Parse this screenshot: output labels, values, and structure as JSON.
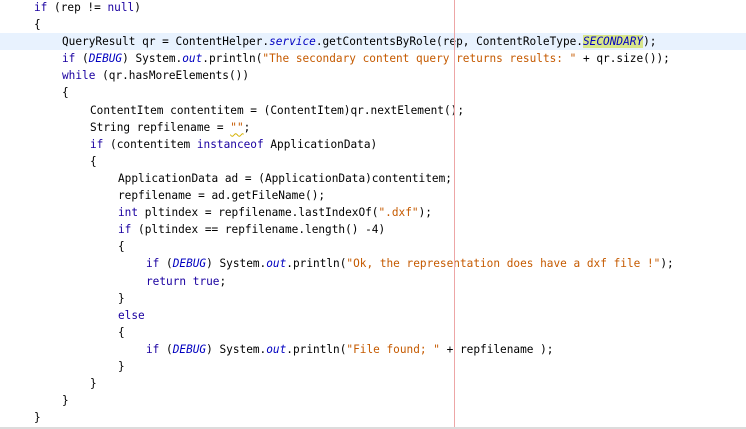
{
  "editor": {
    "lines": [
      {
        "tokens": [
          {
            "t": "if",
            "c": "kw"
          },
          {
            "t": " (rep != "
          },
          {
            "t": "null",
            "c": "kw"
          },
          {
            "t": ")"
          }
        ]
      },
      {
        "tokens": [
          {
            "t": "{"
          }
        ]
      },
      {
        "indent": 1,
        "current": true,
        "tokens": [
          {
            "t": "QueryResult qr = ContentHelper."
          },
          {
            "t": "service",
            "c": "field"
          },
          {
            "t": ".getContentsByRole(rep, ContentRoleType."
          },
          {
            "t": "SECONDARY",
            "c": "field hl"
          },
          {
            "t": ");"
          }
        ]
      },
      {
        "indent": 1,
        "tokens": [
          {
            "t": "if",
            "c": "kw"
          },
          {
            "t": " ("
          },
          {
            "t": "DEBUG",
            "c": "field"
          },
          {
            "t": ") System."
          },
          {
            "t": "out",
            "c": "field"
          },
          {
            "t": ".println("
          },
          {
            "t": "\"The secondary content query returns results: \"",
            "c": "str"
          },
          {
            "t": " + qr.size());"
          }
        ]
      },
      {
        "indent": 1,
        "tokens": [
          {
            "t": "while",
            "c": "kw"
          },
          {
            "t": " (qr.hasMoreElements())"
          }
        ]
      },
      {
        "indent": 1,
        "tokens": [
          {
            "t": "{"
          }
        ]
      },
      {
        "indent": 2,
        "tokens": [
          {
            "t": "ContentItem contentitem = (ContentItem)qr.nextElement();"
          }
        ]
      },
      {
        "indent": 2,
        "tokens": [
          {
            "t": "String repfilename = "
          },
          {
            "t": "\"\"",
            "c": "str squig"
          },
          {
            "t": ";"
          }
        ]
      },
      {
        "indent": 2,
        "tokens": [
          {
            "t": "if",
            "c": "kw"
          },
          {
            "t": " (contentitem "
          },
          {
            "t": "instanceof",
            "c": "kw"
          },
          {
            "t": " ApplicationData)"
          }
        ]
      },
      {
        "indent": 2,
        "tokens": [
          {
            "t": "{"
          }
        ]
      },
      {
        "indent": 3,
        "tokens": [
          {
            "t": "ApplicationData ad = (ApplicationData)contentitem;"
          }
        ]
      },
      {
        "indent": 3,
        "tokens": [
          {
            "t": "repfilename = ad.getFileName();"
          }
        ]
      },
      {
        "indent": 3,
        "tokens": [
          {
            "t": "int",
            "c": "kw"
          },
          {
            "t": " pltindex = repfilename.lastIndexOf("
          },
          {
            "t": "\".dxf\"",
            "c": "str"
          },
          {
            "t": ");"
          }
        ]
      },
      {
        "indent": 3,
        "tokens": [
          {
            "t": "if",
            "c": "kw"
          },
          {
            "t": " (pltindex == repfilename.length() -4)"
          }
        ]
      },
      {
        "indent": 3,
        "tokens": [
          {
            "t": "{"
          }
        ]
      },
      {
        "indent": 4,
        "tokens": [
          {
            "t": "if",
            "c": "kw"
          },
          {
            "t": " ("
          },
          {
            "t": "DEBUG",
            "c": "field"
          },
          {
            "t": ") System."
          },
          {
            "t": "out",
            "c": "field"
          },
          {
            "t": ".println("
          },
          {
            "t": "\"Ok, the representation does have a dxf file !\"",
            "c": "str"
          },
          {
            "t": ");"
          }
        ]
      },
      {
        "indent": 4,
        "tokens": [
          {
            "t": "return",
            "c": "kw"
          },
          {
            "t": " "
          },
          {
            "t": "true",
            "c": "kw"
          },
          {
            "t": ";"
          }
        ]
      },
      {
        "indent": 3,
        "tokens": [
          {
            "t": "}"
          }
        ]
      },
      {
        "indent": 3,
        "tokens": [
          {
            "t": "else",
            "c": "kw"
          }
        ]
      },
      {
        "indent": 3,
        "tokens": [
          {
            "t": "{"
          }
        ]
      },
      {
        "indent": 4,
        "tokens": [
          {
            "t": "if",
            "c": "kw"
          },
          {
            "t": " ("
          },
          {
            "t": "DEBUG",
            "c": "field"
          },
          {
            "t": ") System."
          },
          {
            "t": "out",
            "c": "field"
          },
          {
            "t": ".println("
          },
          {
            "t": "\"File found; \"",
            "c": "str"
          },
          {
            "t": " + repfilename );"
          }
        ]
      },
      {
        "indent": 3,
        "tokens": [
          {
            "t": "}"
          }
        ]
      },
      {
        "indent": 2,
        "tokens": [
          {
            "t": "}"
          }
        ]
      },
      {
        "indent": 1,
        "tokens": [
          {
            "t": "}"
          }
        ]
      },
      {
        "tokens": [
          {
            "t": "}"
          }
        ]
      }
    ]
  }
}
